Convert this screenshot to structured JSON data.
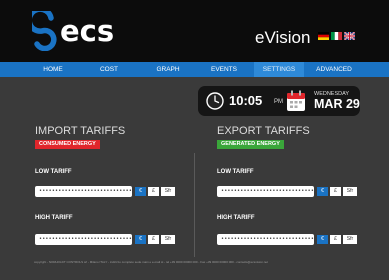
{
  "header": {
    "logo_text": "ecs",
    "product_name": "eVision",
    "languages": [
      {
        "code": "de",
        "icon": "german-flag-icon"
      },
      {
        "code": "it",
        "icon": "italian-flag-icon"
      },
      {
        "code": "en",
        "icon": "british-flag-icon"
      }
    ]
  },
  "nav": {
    "items": [
      {
        "label": "HOME"
      },
      {
        "label": "COST"
      },
      {
        "label": "GRAPH"
      },
      {
        "label": "EVENTS"
      },
      {
        "label": "SETTINGS",
        "active": true
      },
      {
        "label": "ADVANCED"
      }
    ]
  },
  "datetime": {
    "time": "10:05",
    "ampm": "PM",
    "weekday": "WEDNESDAY",
    "date": "MAR 29"
  },
  "import": {
    "title": "IMPORT TARIFFS",
    "badge": "CONSUMED ENERGY",
    "badge_color": "#e0262b",
    "low_label": "LOW TARIFF",
    "low_value": "••••••••••••••••••••••••••••••••",
    "high_label": "HIGH TARIFF",
    "high_value": "••••••••••••••••••••••••••••••••"
  },
  "export": {
    "title": "EXPORT TARIFFS",
    "badge": "GENERATED ENERGY",
    "badge_color": "#3aa63a",
    "low_label": "LOW TARIFF",
    "low_value": "••••••••••••••••••••••••••••••••",
    "high_label": "HIGH TARIFF",
    "high_value": "••••••••••••••••••••••••••••••••"
  },
  "currency": {
    "options": [
      "€",
      "£",
      "Sfr"
    ],
    "selected": "€"
  },
  "footer": {
    "text": "copyright - NORHOLDT CONTROLS srl - Milano ITALY - indirizzo completo sede main e e-mail st - tel +39 0000 00000 000 - Fax +39 0000 00000 000 - contacts@ecsvision.net"
  },
  "colors": {
    "accent": "#1a73c4",
    "background": "#3a3a3a",
    "header": "#0c0c0c"
  }
}
